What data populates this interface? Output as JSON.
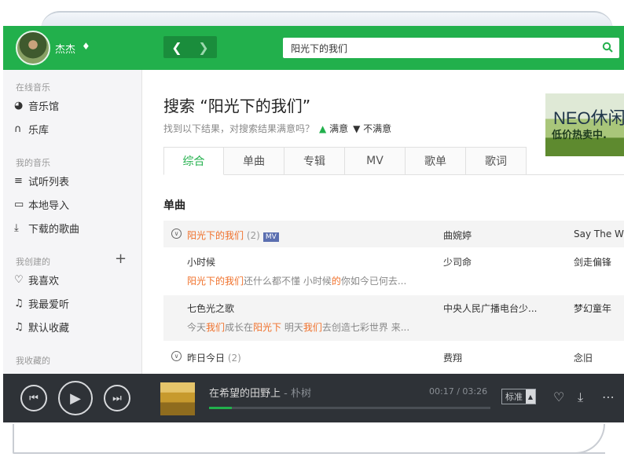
{
  "user": {
    "name": "杰杰"
  },
  "search": {
    "query": "阳光下的我们"
  },
  "sidebar": {
    "online_section": "在线音乐",
    "music_hall": "音乐馆",
    "library": "乐库",
    "my_music_section": "我的音乐",
    "trial_list": "试听列表",
    "local_import": "本地导入",
    "downloaded": "下载的歌曲",
    "created_section": "我创建的",
    "my_likes": "我喜欢",
    "most_loved": "我最爱听",
    "default_collection": "默认收藏",
    "collected_section": "我收藏的"
  },
  "results": {
    "title": "搜索 “阳光下的我们”",
    "feedback_question": "找到以下结果，对搜索结果满意吗？",
    "satisfied": "满意",
    "unsatisfied": "不满意",
    "tabs": [
      "综合",
      "单曲",
      "专辑",
      "MV",
      "歌单",
      "歌词"
    ],
    "section": "单曲",
    "rows": [
      {
        "song": "阳光下的我们",
        "count": "(2)",
        "mv": "MV",
        "artist": "曲婉婷",
        "album": "Say The W"
      },
      {
        "song": "小时候",
        "artist": "少司命",
        "album": "剑走偏锋",
        "lyric_parts": [
          "阳光下的我们",
          "还什么都不懂 小时候",
          "的",
          "你如今已何去..."
        ]
      },
      {
        "song": "七色光之歌",
        "artist": "中央人民广播电台少...",
        "album": "梦幻童年 ",
        "lyric_parts": [
          "今天",
          "我们",
          "成长在",
          "阳光下",
          " 明天",
          "我们",
          "去创造七彩世界 来..."
        ]
      },
      {
        "song": "昨日今日",
        "count": "(2)",
        "artist": "费翔",
        "album": "念旧"
      }
    ]
  },
  "banner": {
    "line1": "NEO休闲",
    "line2": "低价热卖中."
  },
  "player": {
    "track": "在希望的田野上",
    "separator": " - ",
    "artist": "朴树",
    "time": "00:17 / 03:26",
    "quality": "标准",
    "progress": 0.082
  },
  "colors": {
    "accent": "#22b04c",
    "highlight": "#f0702a",
    "player_bg": "#2e3237"
  }
}
